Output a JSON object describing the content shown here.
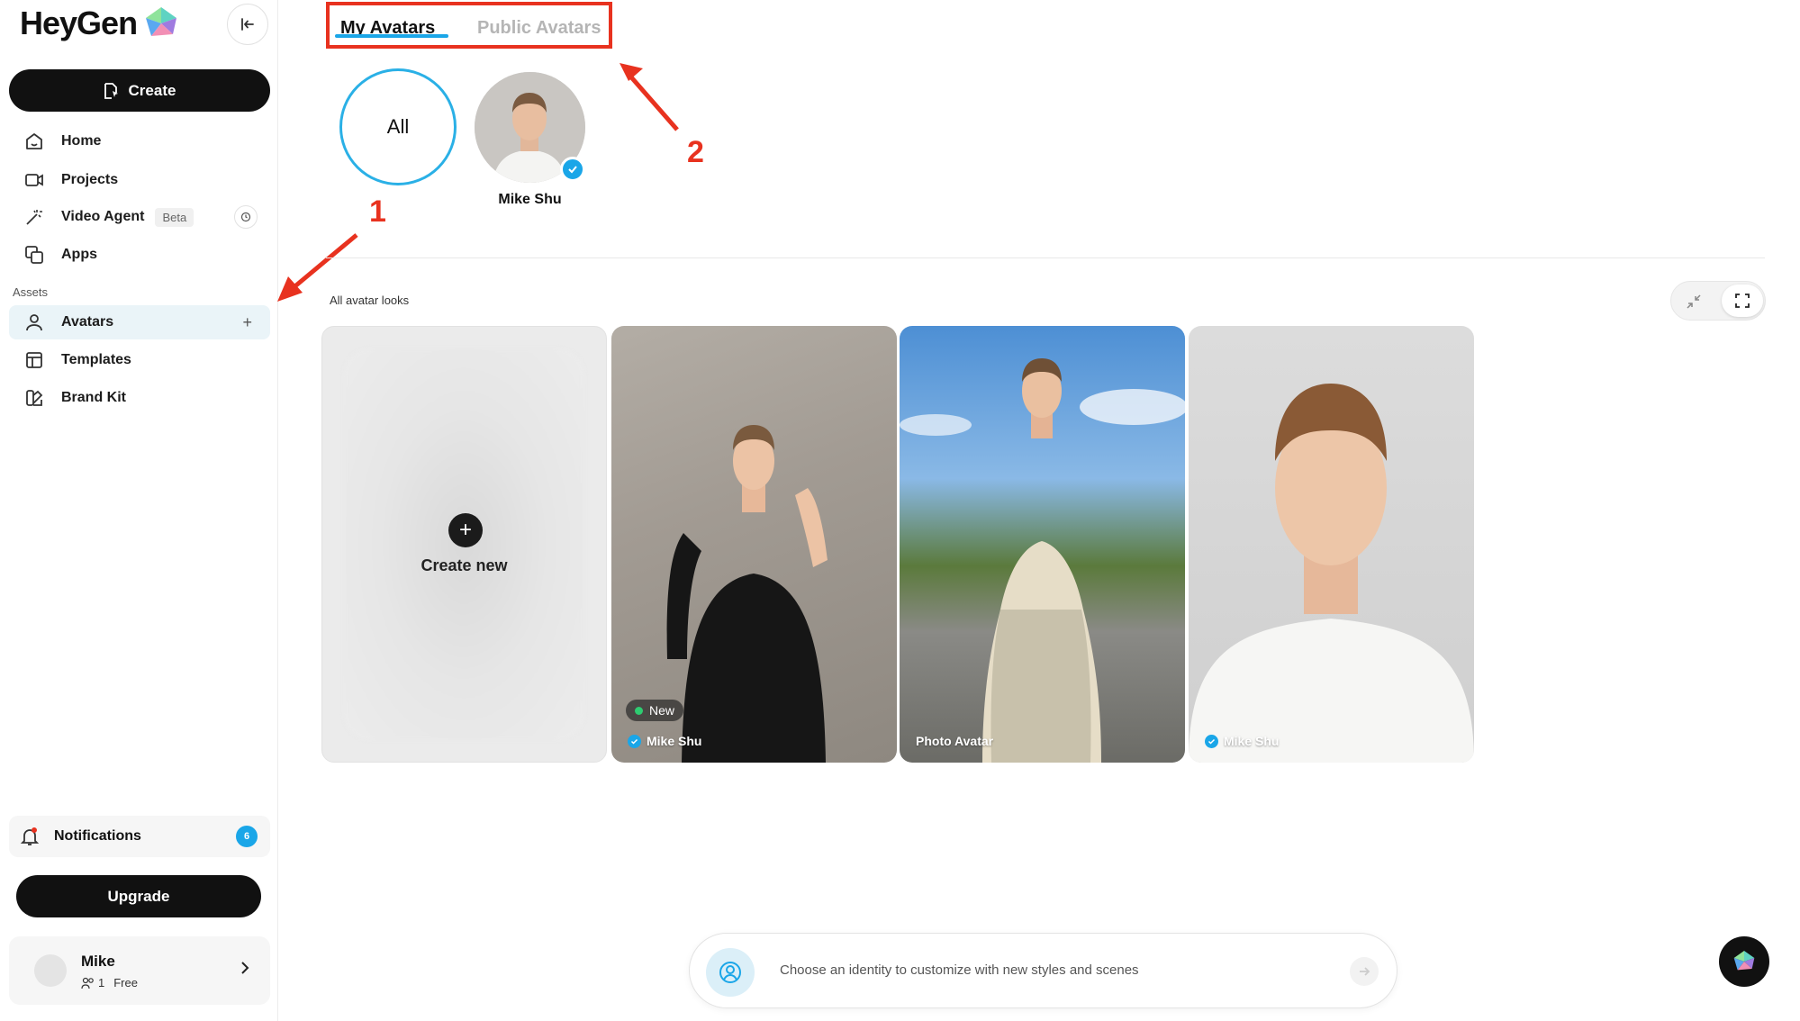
{
  "app": {
    "logo_text": "HeyGen",
    "accent_color": "#1aa6e8",
    "annotation_color": "#e8321f"
  },
  "sidebar": {
    "create_label": "Create",
    "nav": [
      {
        "label": "Home",
        "icon": "home-icon"
      },
      {
        "label": "Projects",
        "icon": "video-icon"
      },
      {
        "label": "Video Agent",
        "icon": "wand-icon",
        "badge": "Beta"
      },
      {
        "label": "Apps",
        "icon": "apps-icon"
      }
    ],
    "assets_label": "Assets",
    "assets": [
      {
        "label": "Avatars",
        "icon": "person-icon",
        "active": true
      },
      {
        "label": "Templates",
        "icon": "template-icon"
      },
      {
        "label": "Brand Kit",
        "icon": "brand-kit-icon"
      }
    ],
    "notifications_label": "Notifications",
    "notifications_count": "6",
    "upgrade_label": "Upgrade",
    "user": {
      "name": "Mike",
      "seats": "1",
      "plan": "Free"
    }
  },
  "tabs": {
    "my": "My Avatars",
    "public": "Public Avatars"
  },
  "filters": {
    "all_label": "All",
    "person_name": "Mike Shu"
  },
  "looks": {
    "section_label": "All avatar looks",
    "create_new_label": "Create new",
    "cards": [
      {
        "label": "Mike Shu",
        "verified": true,
        "badge": "New"
      },
      {
        "label": "Photo Avatar",
        "verified": false
      },
      {
        "label": "Mike Shu",
        "verified": true
      }
    ]
  },
  "annotations": {
    "one": "1",
    "two": "2"
  },
  "prompt": {
    "placeholder": "Choose an identity to customize with new styles and scenes"
  }
}
